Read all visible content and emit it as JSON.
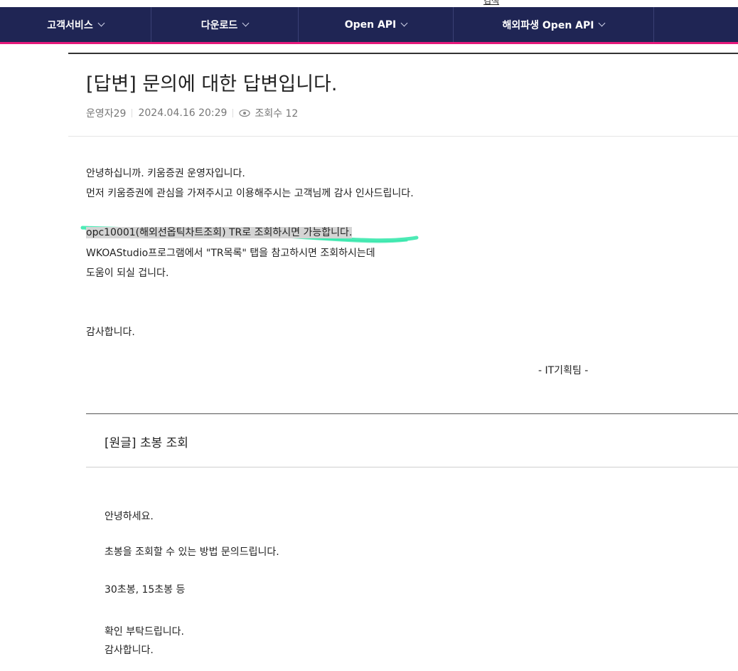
{
  "top_link": "검색",
  "nav": {
    "items": [
      {
        "label": "고객서비스"
      },
      {
        "label": "다운로드"
      },
      {
        "label": "Open API"
      },
      {
        "label": "해외파생 Open API"
      },
      {
        "label": ""
      }
    ]
  },
  "post": {
    "title": "[답변] 문의에 대한 답변입니다.",
    "author": "운영자29",
    "datetime": "2024.04.16 20:29",
    "views_label": "조회수 12",
    "body": {
      "greeting1": "안녕하십니까. 키움증권 운영자입니다.",
      "greeting2": "먼저 키움증권에 관심을 가져주시고 이용해주시는 고객님께 감사 인사드립니다.",
      "answer1": "opc10001(해외선옵틱차트조회) TR로 조회하시면 가능합니다.",
      "answer2": "WKOAStudio프로그램에서 \"TR목록\" 탭을 참고하시면 조회하시는데",
      "answer3": "도움이 되실 겁니다.",
      "thanks": "감사합니다.",
      "signature": "- IT기획팀 -"
    }
  },
  "original": {
    "title": "[원글] 초봉 조회",
    "lines": [
      "안녕하세요.",
      "초봉을 조회할 수 있는 방법 문의드립니다.",
      "30초봉, 15초봉 등",
      "확인 부탁드립니다.",
      "감사합니다."
    ]
  },
  "colors": {
    "nav_bg": "#1f2554",
    "nav_accent": "#e5197b",
    "highlight": "#d4d4d4",
    "marker": "#2ee6a8"
  }
}
